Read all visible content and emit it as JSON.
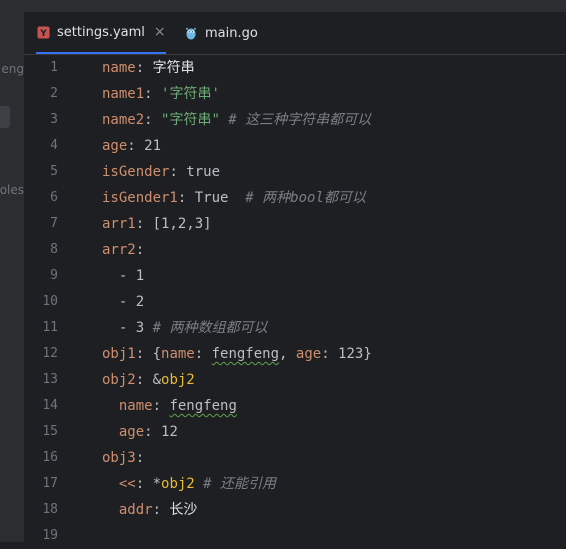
{
  "left_panel": {
    "frag1": "eng",
    "frag2": "oles"
  },
  "tabs": [
    {
      "label": "settings.yaml",
      "icon": "yaml-icon"
    },
    {
      "label": "main.go",
      "icon": "go-gopher-icon"
    }
  ],
  "tab_close": "×",
  "line_numbers": [
    "1",
    "2",
    "3",
    "4",
    "5",
    "6",
    "7",
    "8",
    "9",
    "10",
    "11",
    "12",
    "13",
    "14",
    "15",
    "16",
    "17",
    "18",
    "19"
  ],
  "code": {
    "l1": {
      "key": "name",
      "colon": ": ",
      "val": "字符串"
    },
    "l2": {
      "key": "name1",
      "colon": ": ",
      "val": "'字符串'"
    },
    "l3": {
      "key": "name2",
      "colon": ": ",
      "val": "\"字符串\"",
      "comment": " # 这三种字符串都可以"
    },
    "l4": {
      "key": "age",
      "colon": ": ",
      "val": "21"
    },
    "l5": {
      "key": "isGender",
      "colon": ": ",
      "val": "true"
    },
    "l6": {
      "key": "isGender1",
      "colon": ": ",
      "val": "True",
      "comment": "  # 两种bool都可以"
    },
    "l7": {
      "key": "arr1",
      "colon": ": ",
      "val": "[1,2,3]"
    },
    "l8": {
      "key": "arr2",
      "colon": ":"
    },
    "l9": {
      "val": "  - 1"
    },
    "l10": {
      "val": "  - 2"
    },
    "l11": {
      "val": "  - 3",
      "comment": " # 两种数组都可以"
    },
    "l12": {
      "key": "obj1",
      "p1": ": {",
      "k1": "name",
      "p2": ": ",
      "v1": "fengfeng",
      "p3": ", ",
      "k2": "age",
      "p4": ": ",
      "v2": "123",
      "p5": "}"
    },
    "l13": {
      "key": "obj2",
      "colon": ": &",
      "anchor": "obj2"
    },
    "l14": {
      "key": "name",
      "colon": ": ",
      "val": "fengfeng"
    },
    "l15": {
      "key": "age",
      "colon": ": ",
      "val": "12"
    },
    "l16": {
      "key": "obj3",
      "colon": ":"
    },
    "l17": {
      "key": "<<",
      "colon": ": *",
      "anchor": "obj2",
      "comment": " # 还能引用"
    },
    "l18": {
      "key": "addr",
      "colon": ": ",
      "val": "长沙"
    }
  }
}
